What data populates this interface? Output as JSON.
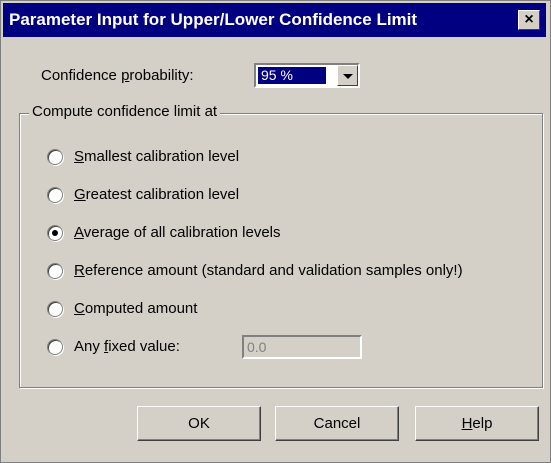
{
  "window": {
    "title": "Parameter Input for Upper/Lower Confidence Limit",
    "close_glyph": "×"
  },
  "confidence": {
    "label_pre": "Confidence ",
    "label_mnemonic": "p",
    "label_post": "robability:",
    "value": "95 %"
  },
  "group": {
    "title": "Compute confidence limit at",
    "options": [
      {
        "mnemonic": "S",
        "rest": "mallest calibration level",
        "checked": false
      },
      {
        "mnemonic": "G",
        "rest": "reatest calibration level",
        "checked": false
      },
      {
        "mnemonic": "A",
        "rest": "verage of  all calibration levels",
        "checked": true
      },
      {
        "mnemonic": "R",
        "rest": "eference amount (standard and validation samples only!)",
        "checked": false
      },
      {
        "mnemonic": "C",
        "rest": "omputed amount",
        "checked": false
      }
    ],
    "fixed": {
      "pre": "Any ",
      "mnemonic": "f",
      "post": "ixed value:",
      "value": "0.0",
      "checked": false
    }
  },
  "buttons": {
    "ok": "OK",
    "cancel": "Cancel",
    "help_mnemonic": "H",
    "help_rest": "elp"
  }
}
